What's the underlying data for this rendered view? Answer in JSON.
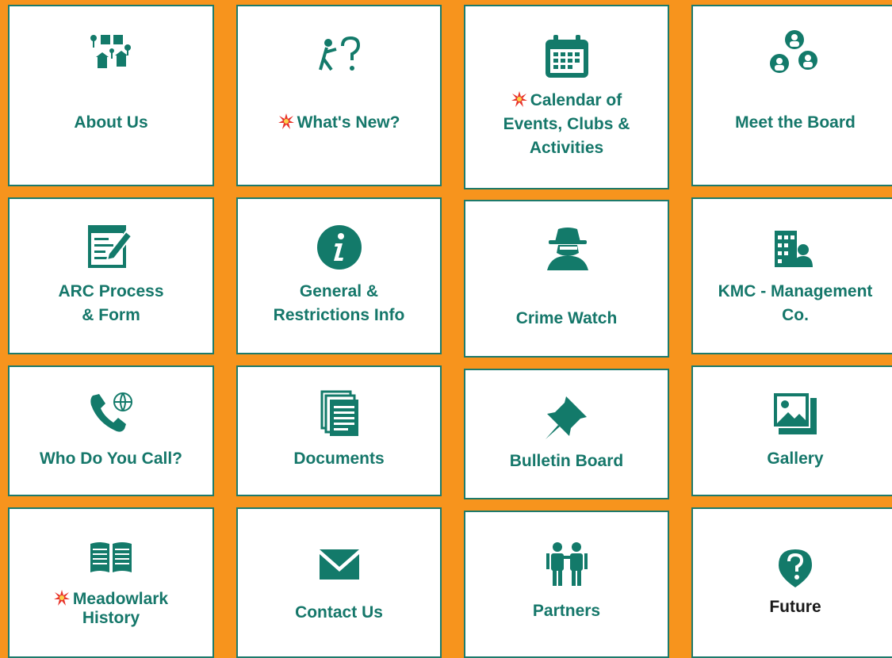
{
  "colors": {
    "background": "#f7941d",
    "tile_border": "#1d7a6b",
    "text": "#15776a",
    "accent_new": "#e8332a"
  },
  "tiles": [
    {
      "label": [
        "About Us"
      ],
      "icon": "neighborhood-houses-icon",
      "new": false
    },
    {
      "label": [
        "What's New?"
      ],
      "icon": "question-figure-icon",
      "new": true
    },
    {
      "label": [
        "Calendar of",
        "Events, Clubs &",
        "Activities"
      ],
      "icon": "calendar-icon",
      "new": true
    },
    {
      "label": [
        "Meet the Board"
      ],
      "icon": "board-people-icon",
      "new": false
    },
    {
      "label": [
        "ARC Process",
        "& Form"
      ],
      "icon": "form-pencil-icon",
      "new": false
    },
    {
      "label": [
        "General  &",
        "Restrictions Info"
      ],
      "icon": "info-icon",
      "new": false
    },
    {
      "label": [
        "Crime Watch"
      ],
      "icon": "detective-icon",
      "new": false
    },
    {
      "label": [
        "KMC - Management",
        "Co."
      ],
      "icon": "building-person-icon",
      "new": false
    },
    {
      "label": [
        "Who Do You Call?"
      ],
      "icon": "phone-globe-icon",
      "new": false
    },
    {
      "label": [
        "Documents"
      ],
      "icon": "documents-icon",
      "new": false
    },
    {
      "label": [
        "Bulletin Board"
      ],
      "icon": "pushpin-icon",
      "new": false
    },
    {
      "label": [
        "Gallery"
      ],
      "icon": "gallery-icon",
      "new": false
    },
    {
      "label": [
        "Meadowlark",
        "History"
      ],
      "icon": "open-book-icon",
      "new": true
    },
    {
      "label": [
        "Contact Us"
      ],
      "icon": "envelope-icon",
      "new": false
    },
    {
      "label": [
        "Partners"
      ],
      "icon": "partners-icon",
      "new": false
    },
    {
      "label": [
        "Future"
      ],
      "icon": "question-bubble-icon",
      "new": false
    }
  ]
}
